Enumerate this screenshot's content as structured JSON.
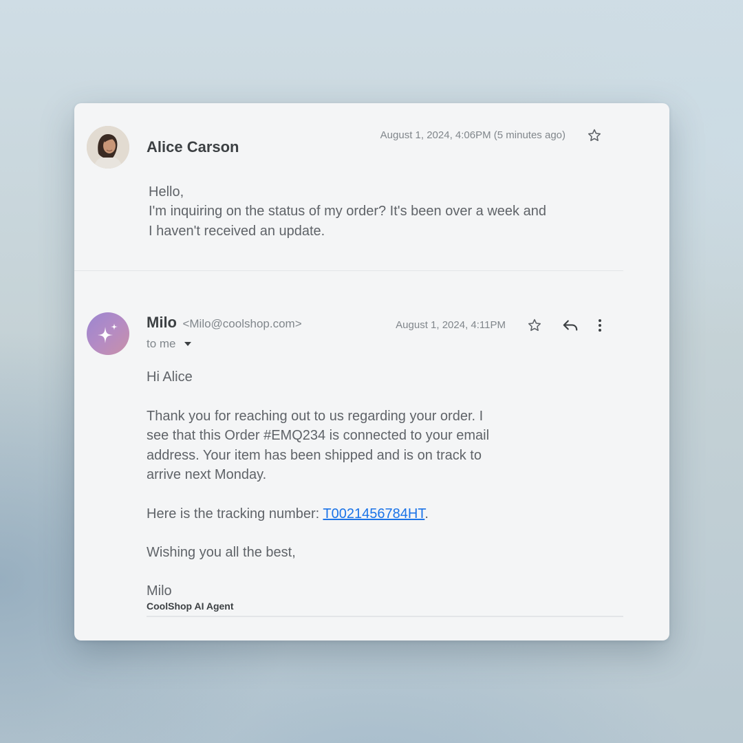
{
  "thread": {
    "messages": [
      {
        "sender_name": "Alice Carson",
        "timestamp": "August 1, 2024, 4:06PM (5 minutes ago)",
        "body_lines": [
          "Hello,",
          "I'm inquiring on the status of my order? It's been over a week and",
          "I haven't received an update."
        ],
        "icons": {
          "star": "star-icon"
        }
      },
      {
        "sender_name": "Milo",
        "sender_email": "<Milo@coolshop.com>",
        "recipient": "to me",
        "timestamp": "August 1, 2024, 4:11PM",
        "greeting": "Hi Alice",
        "paragraph_lines": [
          "Thank you for reaching out to us regarding your order. I",
          "see that this Order #EMQ234 is connected to your email",
          "address. Your item has been shipped and is on track to",
          "arrive next Monday."
        ],
        "tracking_prefix": "Here is the tracking number: ",
        "tracking_number": "T0021456784HT",
        "tracking_suffix": ".",
        "closing": "Wishing you all the best,",
        "signature_name": "Milo",
        "signature_title": "CoolShop AI Agent",
        "icons": {
          "star": "star-icon",
          "reply": "reply-icon",
          "more": "more-vertical-icon",
          "avatar": "sparkle-icon",
          "recipient_dropdown": "caret-down-icon"
        }
      }
    ]
  },
  "colors": {
    "link": "#1a73e8",
    "avatar_gradient": [
      "#9b86d0",
      "#c890a8"
    ],
    "text_primary": "#3c4043",
    "text_secondary": "#5f6368"
  }
}
